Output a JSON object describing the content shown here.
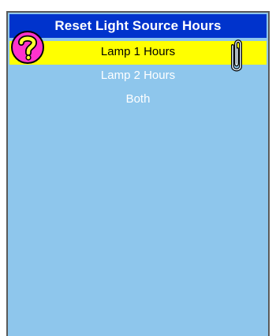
{
  "menu": {
    "title": "Reset Light Source Hours",
    "items": [
      {
        "label": "Lamp 1 Hours",
        "selected": true
      },
      {
        "label": "Lamp 2 Hours",
        "selected": false
      },
      {
        "label": "Both",
        "selected": false
      }
    ]
  },
  "icons": {
    "help": "question-mark-help-icon",
    "attachment": "paperclip-icon"
  },
  "colors": {
    "panel_background": "#8ec6ec",
    "title_background": "#0033cc",
    "title_text": "#ffffff",
    "selected_highlight": "#ffff00",
    "item_text": "#ffffff",
    "help_icon_fill": "#ff33cc",
    "help_icon_glyph": "#ffff33",
    "panel_border": "#5a5a5a"
  }
}
